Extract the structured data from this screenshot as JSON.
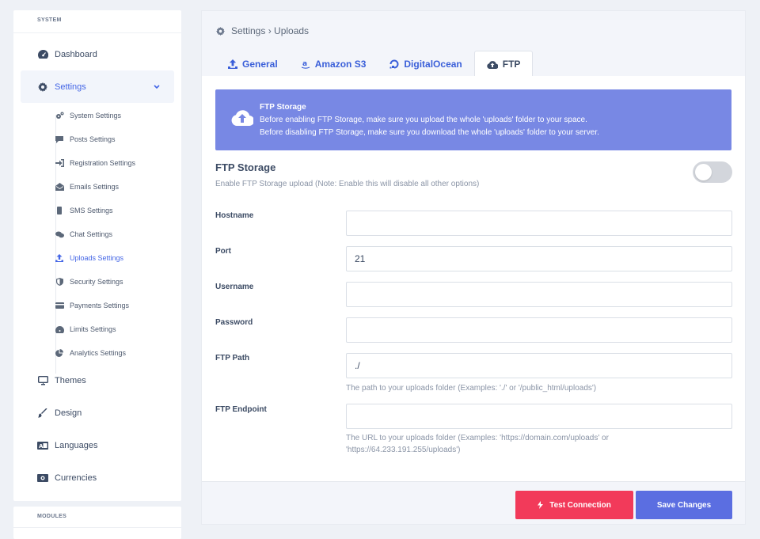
{
  "sidebar": {
    "caption": "SYSTEM",
    "items": [
      {
        "label": "Dashboard",
        "icon": "gauge-icon"
      },
      {
        "label": "Settings",
        "icon": "gear-icon",
        "expanded": true
      },
      {
        "label": "Themes",
        "icon": "monitor-icon"
      },
      {
        "label": "Design",
        "icon": "brush-icon"
      },
      {
        "label": "Languages",
        "icon": "language-icon"
      },
      {
        "label": "Currencies",
        "icon": "money-icon"
      }
    ],
    "settings_sub": [
      {
        "label": "System Settings",
        "icon": "cogs-icon"
      },
      {
        "label": "Posts Settings",
        "icon": "comment-icon"
      },
      {
        "label": "Registration Settings",
        "icon": "sign-in-icon"
      },
      {
        "label": "Emails Settings",
        "icon": "envelope-open-icon"
      },
      {
        "label": "SMS Settings",
        "icon": "mobile-icon"
      },
      {
        "label": "Chat Settings",
        "icon": "comments-icon"
      },
      {
        "label": "Uploads Settings",
        "icon": "upload-icon",
        "active": true
      },
      {
        "label": "Security Settings",
        "icon": "shield-icon"
      },
      {
        "label": "Payments Settings",
        "icon": "credit-card-icon"
      },
      {
        "label": "Limits Settings",
        "icon": "gauge-icon"
      },
      {
        "label": "Analytics Settings",
        "icon": "pie-chart-icon"
      }
    ],
    "modules_caption": "MODULES"
  },
  "breadcrumb": {
    "text": "Settings › Uploads"
  },
  "tabs": [
    {
      "label": "General",
      "icon": "upload-icon"
    },
    {
      "label": "Amazon S3",
      "icon": "amazon-icon"
    },
    {
      "label": "DigitalOcean",
      "icon": "digitalocean-icon"
    },
    {
      "label": "FTP",
      "icon": "cloud-upload-icon",
      "active": true
    }
  ],
  "alert": {
    "title": "FTP Storage",
    "line1": "Before enabling FTP Storage, make sure you upload the whole 'uploads' folder to your space.",
    "line2": "Before disabling FTP Storage, make sure you download the whole 'uploads' folder to your server."
  },
  "ftp_storage": {
    "title": "FTP Storage",
    "description": "Enable FTP Storage upload (Note: Enable this will disable all other options)",
    "enabled": false
  },
  "fields": {
    "hostname": {
      "label": "Hostname",
      "value": ""
    },
    "port": {
      "label": "Port",
      "value": "21"
    },
    "username": {
      "label": "Username",
      "value": ""
    },
    "password": {
      "label": "Password",
      "value": ""
    },
    "ftp_path": {
      "label": "FTP Path",
      "value": "./",
      "help": "The path to your uploads folder (Examples: './' or '/public_html/uploads')"
    },
    "ftp_endpoint": {
      "label": "FTP Endpoint",
      "value": "",
      "help": "The URL to your uploads folder (Examples: 'https://domain.com/uploads' or 'https://64.233.191.255/uploads')"
    }
  },
  "buttons": {
    "test": "Test Connection",
    "save": "Save Changes"
  },
  "colors": {
    "accent": "#4466e6",
    "alert_bg": "#7888e4",
    "danger": "#f23a5a",
    "primary_btn": "#5b6ee1"
  }
}
